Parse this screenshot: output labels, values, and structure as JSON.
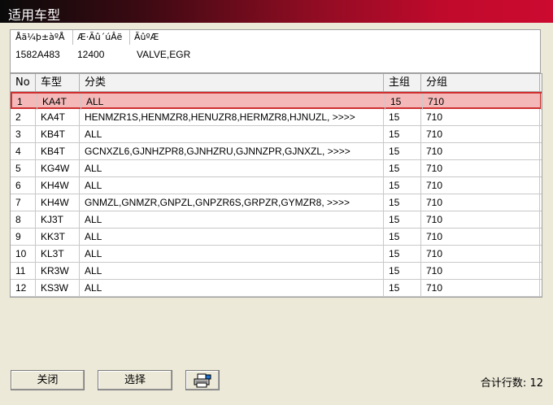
{
  "window": {
    "title": "适用车型"
  },
  "info": {
    "headers": [
      "Åä¼þ±àºÅ",
      "Æ·Ãû´úÂë",
      "ÃûºÆ"
    ],
    "values": [
      "1582A483",
      "12400",
      "VALVE,EGR"
    ]
  },
  "grid": {
    "columns": [
      "No",
      "车型",
      "分类",
      "主组",
      "分组"
    ],
    "rows": [
      [
        "1",
        "KA4T",
        "ALL",
        "15",
        "710"
      ],
      [
        "2",
        "KA4T",
        "HENMZR1S,HENMZR8,HENUZR8,HERMZR8,HJNUZL, >>>>",
        "15",
        "710"
      ],
      [
        "3",
        "KB4T",
        "ALL",
        "15",
        "710"
      ],
      [
        "4",
        "KB4T",
        "GCNXZL6,GJNHZPR8,GJNHZRU,GJNNZPR,GJNXZL, >>>>",
        "15",
        "710"
      ],
      [
        "5",
        "KG4W",
        "ALL",
        "15",
        "710"
      ],
      [
        "6",
        "KH4W",
        "ALL",
        "15",
        "710"
      ],
      [
        "7",
        "KH4W",
        "GNMZL,GNMZR,GNPZL,GNPZR6S,GRPZR,GYMZR8, >>>>",
        "15",
        "710"
      ],
      [
        "8",
        "KJ3T",
        "ALL",
        "15",
        "710"
      ],
      [
        "9",
        "KK3T",
        "ALL",
        "15",
        "710"
      ],
      [
        "10",
        "KL3T",
        "ALL",
        "15",
        "710"
      ],
      [
        "11",
        "KR3W",
        "ALL",
        "15",
        "710"
      ],
      [
        "12",
        "KS3W",
        "ALL",
        "15",
        "710"
      ]
    ],
    "selected_index": 0
  },
  "footer": {
    "close_label": "关闭",
    "select_label": "选择",
    "print_icon": "printer-icon",
    "row_count_label": "合计行数:",
    "row_count": "12"
  }
}
